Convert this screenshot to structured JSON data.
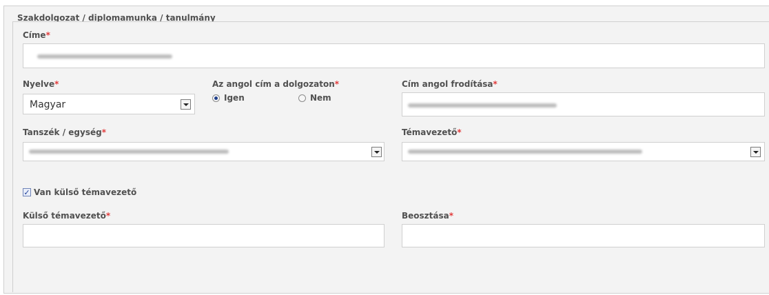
{
  "section_title": "Szakdolgozat / diplomamunka / tanulmány",
  "required_mark": "*",
  "cime": {
    "label": "Címe",
    "value": ""
  },
  "nyelve": {
    "label": "Nyelve",
    "value": "Magyar"
  },
  "angol_cim": {
    "label": "Az angol cím a dolgozaton",
    "options": [
      {
        "label": "Igen",
        "selected": true
      },
      {
        "label": "Nem",
        "selected": false
      }
    ]
  },
  "cim_angol": {
    "label": "Cím angol frodítása",
    "value": ""
  },
  "tanszek": {
    "label": "Tanszék / egység",
    "value": ""
  },
  "temavezeto": {
    "label": "Témavezető",
    "value": ""
  },
  "kulso_checkbox": {
    "label": "Van külső témavezető",
    "checked": true
  },
  "kulso_temavezeto": {
    "label": "Külső témavezető",
    "value": ""
  },
  "beosztasa": {
    "label": "Beosztása",
    "value": ""
  },
  "icons": {
    "dropdown": "chevron-down-icon",
    "check": "check-icon"
  }
}
